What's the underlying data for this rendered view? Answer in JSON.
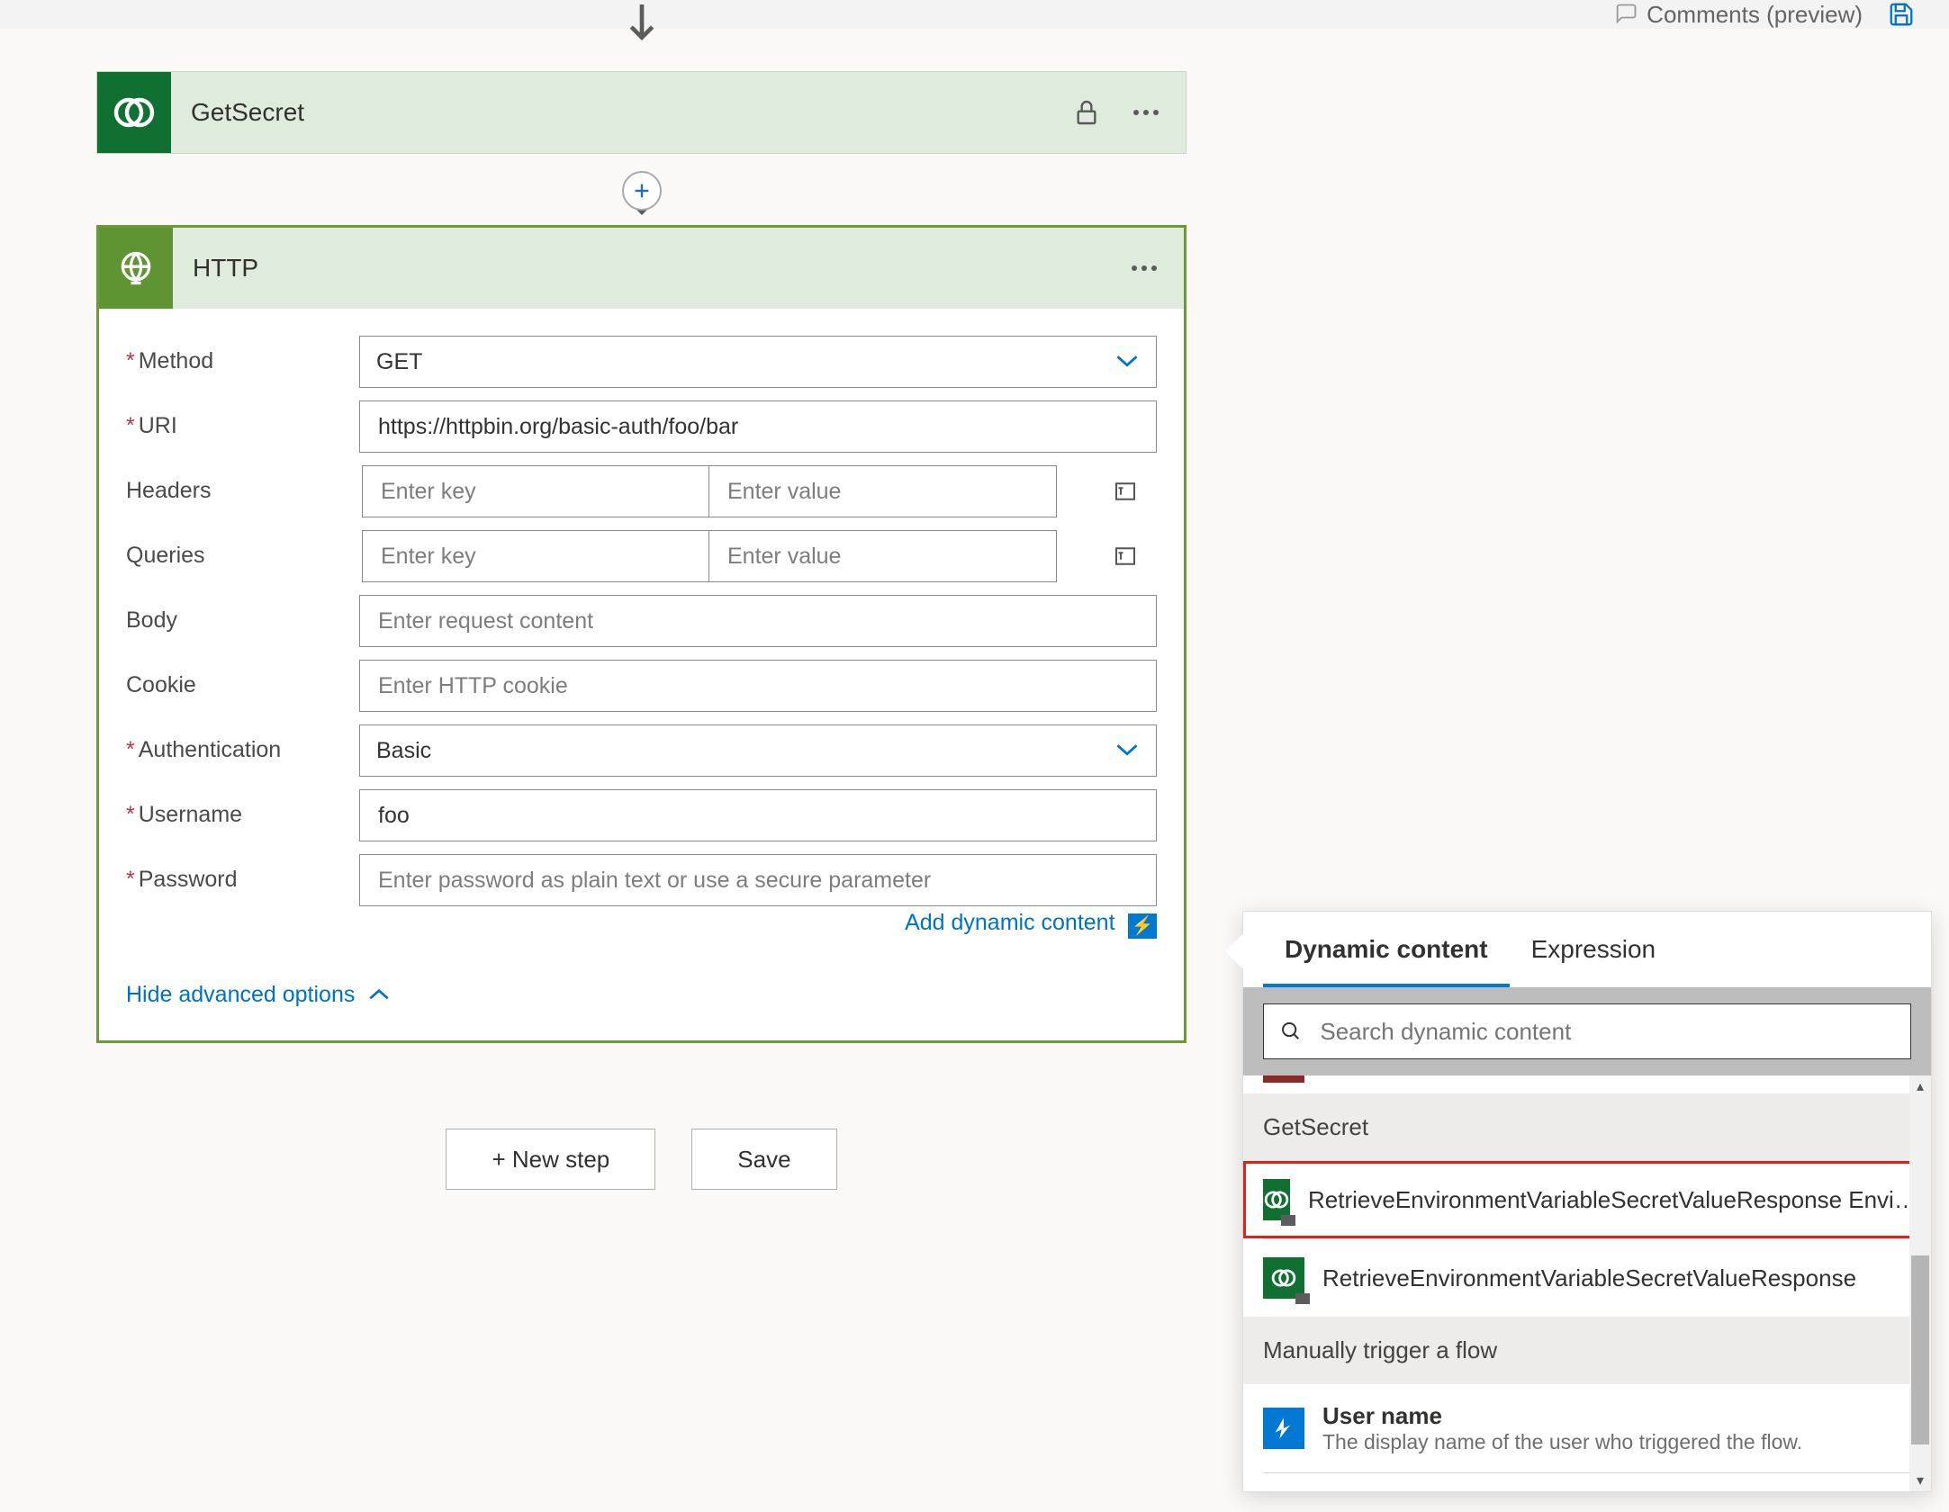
{
  "topbar": {
    "comments": "Comments (preview)"
  },
  "flow": {
    "getsecret": {
      "title": "GetSecret"
    },
    "http": {
      "title": "HTTP",
      "fields": {
        "method": {
          "label": "Method",
          "value": "GET"
        },
        "uri": {
          "label": "URI",
          "value": "https://httpbin.org/basic-auth/foo/bar"
        },
        "headers": {
          "label": "Headers",
          "key_ph": "Enter key",
          "val_ph": "Enter value"
        },
        "queries": {
          "label": "Queries",
          "key_ph": "Enter key",
          "val_ph": "Enter value"
        },
        "body": {
          "label": "Body",
          "ph": "Enter request content"
        },
        "cookie": {
          "label": "Cookie",
          "ph": "Enter HTTP cookie"
        },
        "auth": {
          "label": "Authentication",
          "value": "Basic"
        },
        "user": {
          "label": "Username",
          "value": "foo"
        },
        "pass": {
          "label": "Password",
          "ph": "Enter password as plain text or use a secure parameter"
        }
      },
      "add_dynamic": "Add dynamic content",
      "hide_adv": "Hide advanced options"
    }
  },
  "actions": {
    "newstep": "+ New step",
    "save": "Save"
  },
  "dynpanel": {
    "tabs": {
      "dynamic": "Dynamic content",
      "expression": "Expression"
    },
    "search_ph": "Search dynamic content",
    "sections": {
      "getsecret": {
        "title": "GetSecret",
        "items": [
          {
            "title": "RetrieveEnvironmentVariableSecretValueResponse Envi…"
          },
          {
            "title": "RetrieveEnvironmentVariableSecretValueResponse"
          }
        ]
      },
      "manual": {
        "title": "Manually trigger a flow",
        "items": [
          {
            "title": "User name",
            "sub": "The display name of the user who triggered the flow."
          }
        ]
      }
    }
  }
}
